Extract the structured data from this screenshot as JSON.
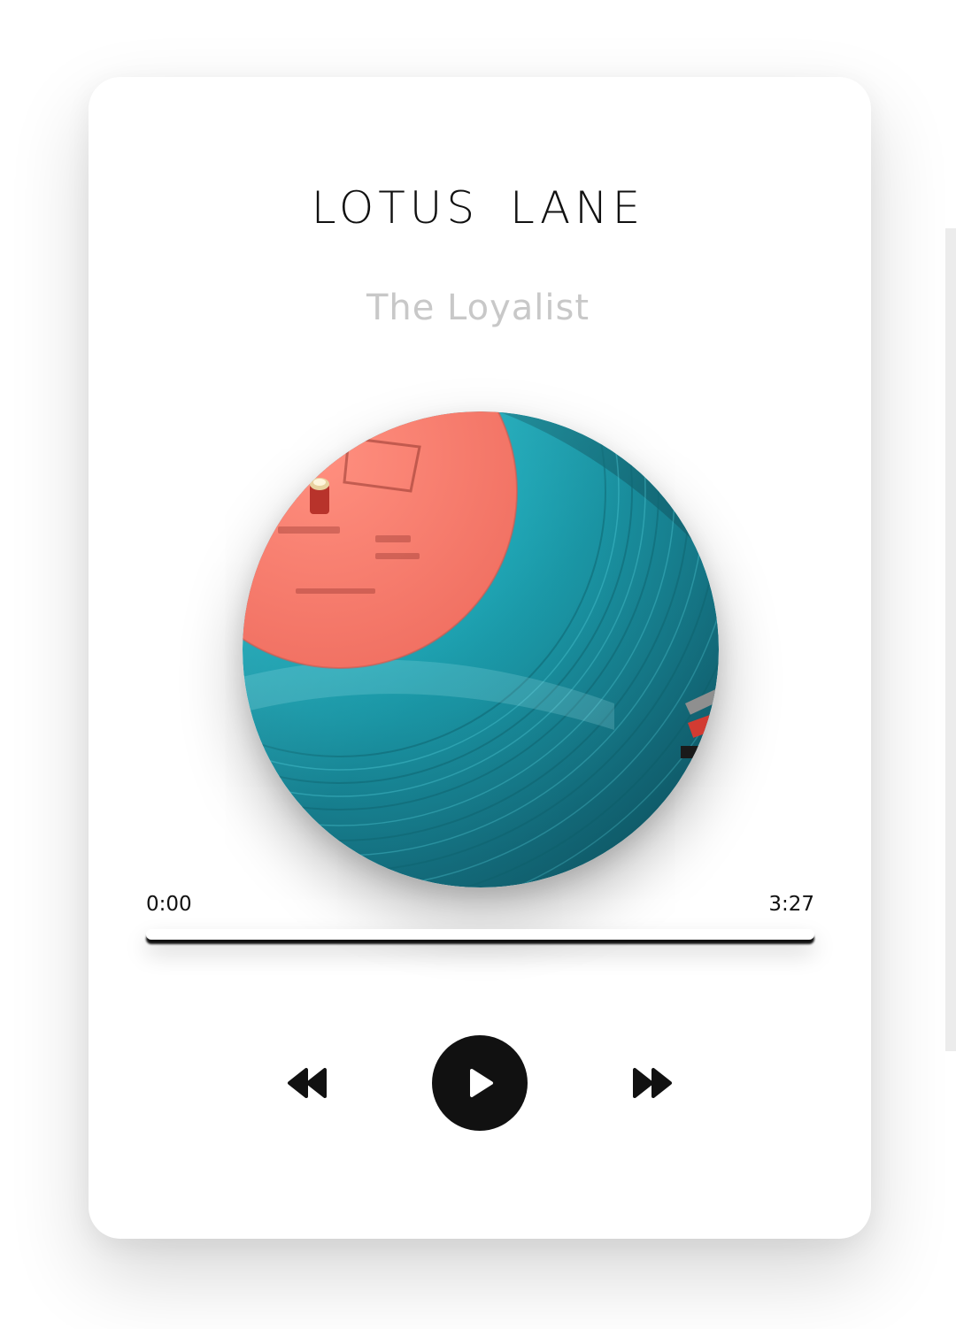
{
  "player": {
    "title": "LOTUS LANE",
    "artist": "The Loyalist",
    "time_current": "0:00",
    "time_total": "3:27",
    "progress_percent": 0
  },
  "icons": {
    "rewind": "rewind-icon",
    "play": "play-icon",
    "forward": "fast-forward-icon"
  },
  "colors": {
    "text": "#111111",
    "artist_text": "#c8c8c8",
    "button": "#111111",
    "record_label": "#f27a6b",
    "vinyl": "#1a8f9e"
  }
}
